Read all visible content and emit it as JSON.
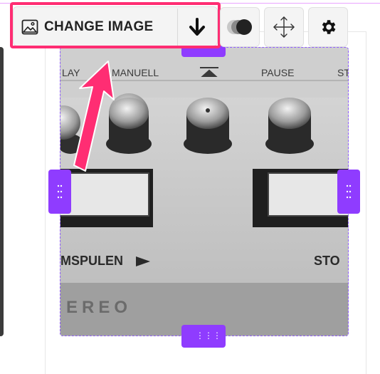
{
  "toolbar": {
    "change_image_label": "CHANGE IMAGE"
  },
  "image": {
    "labels": [
      "LAY",
      "MANUELL",
      "PAUSE",
      "ST",
      "MSPULEN",
      "STO",
      "EREO"
    ]
  },
  "colors": {
    "highlight": "#ff2d73",
    "handle": "#8f3cff",
    "selection_outline": "#8f5cff"
  },
  "icons": [
    "image-icon",
    "download-arrow-icon",
    "toggle-icon",
    "move-icon",
    "gear-icon",
    "grip-dots-icon",
    "annotation-arrow"
  ]
}
